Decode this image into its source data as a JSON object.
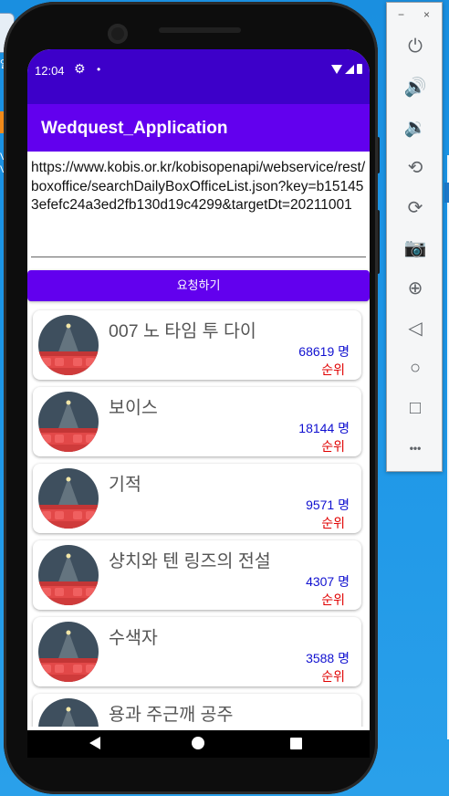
{
  "desktop": {
    "icon_labels": [
      "알",
      "V",
      "Vo"
    ]
  },
  "status_bar": {
    "time": "12:04",
    "gear": "⚙",
    "dot": "•"
  },
  "app": {
    "title": "Wedquest_Application",
    "url_value": "https://www.kobis.or.kr/kobisopenapi/webservice/rest/boxoffice/searchDailyBoxOfficeList.json?key=b151453efefc24a3ed2fb130d19c4299&targetDt=20211001",
    "request_button": "요청하기"
  },
  "movies": [
    {
      "title": "007 노 타임 투 다이",
      "audience": "68619 명",
      "rank_label": "순위"
    },
    {
      "title": "보이스",
      "audience": "18144 명",
      "rank_label": "순위"
    },
    {
      "title": "기적",
      "audience": "9571 명",
      "rank_label": "순위"
    },
    {
      "title": "샹치와 텐 링즈의 전설",
      "audience": "4307 명",
      "rank_label": "순위"
    },
    {
      "title": "수색자",
      "audience": "3588 명",
      "rank_label": "순위"
    },
    {
      "title": "용과 주근깨 공주",
      "audience": "",
      "rank_label": ""
    }
  ],
  "emulator_toolbar": {
    "minimize": "−",
    "close": "×",
    "buttons": [
      {
        "icon": "power-icon",
        "glyph": "⏻"
      },
      {
        "icon": "volume-up-icon",
        "glyph": "🔊"
      },
      {
        "icon": "volume-down-icon",
        "glyph": "🔉"
      },
      {
        "icon": "rotate-left-icon",
        "glyph": "⟲"
      },
      {
        "icon": "rotate-right-icon",
        "glyph": "⟳"
      },
      {
        "icon": "camera-icon",
        "glyph": "📷"
      },
      {
        "icon": "zoom-icon",
        "glyph": "⊕"
      },
      {
        "icon": "back-icon",
        "glyph": "◁"
      },
      {
        "icon": "home-icon",
        "glyph": "○"
      },
      {
        "icon": "overview-icon",
        "glyph": "□"
      },
      {
        "icon": "more-icon",
        "glyph": "•••"
      }
    ]
  },
  "colors": {
    "status_bar": "#3d00c9",
    "app_bar": "#6200ee",
    "audience_text": "#1010d0",
    "rank_text": "#e00000"
  }
}
